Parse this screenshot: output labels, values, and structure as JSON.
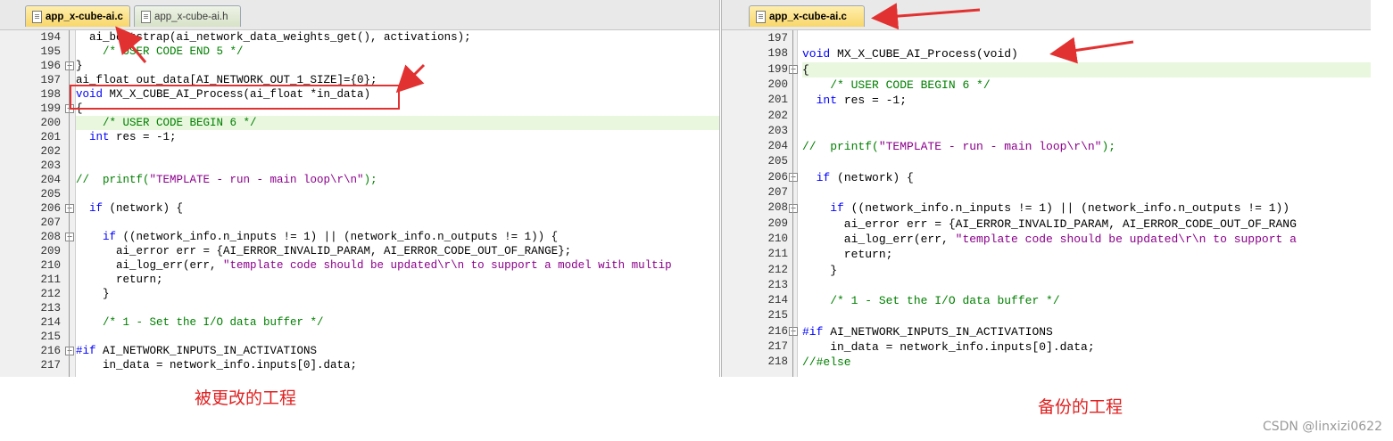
{
  "left": {
    "tabs": [
      {
        "label": "app_x-cube-ai.c",
        "active": true
      },
      {
        "label": "app_x-cube-ai.h",
        "active": false
      }
    ],
    "lines": [
      {
        "n": "194",
        "text": "  ai_bootstrap(ai_network_data_weights_get(), activations);"
      },
      {
        "n": "195",
        "text": "    /* USER CODE END 5 */"
      },
      {
        "n": "196",
        "text": "}"
      },
      {
        "n": "197",
        "text": "ai_float out_data[AI_NETWORK_OUT_1_SIZE]={0};"
      },
      {
        "n": "198",
        "text": "void MX_X_CUBE_AI_Process(ai_float *in_data)"
      },
      {
        "n": "199",
        "text": "{"
      },
      {
        "n": "200",
        "text": "    /* USER CODE BEGIN 6 */"
      },
      {
        "n": "201",
        "text": "  int res = -1;"
      },
      {
        "n": "202",
        "text": ""
      },
      {
        "n": "203",
        "text": ""
      },
      {
        "n": "204",
        "text": "//  printf(\"TEMPLATE - run - main loop\\r\\n\");"
      },
      {
        "n": "205",
        "text": ""
      },
      {
        "n": "206",
        "text": "  if (network) {"
      },
      {
        "n": "207",
        "text": ""
      },
      {
        "n": "208",
        "text": "    if ((network_info.n_inputs != 1) || (network_info.n_outputs != 1)) {"
      },
      {
        "n": "209",
        "text": "      ai_error err = {AI_ERROR_INVALID_PARAM, AI_ERROR_CODE_OUT_OF_RANGE};"
      },
      {
        "n": "210",
        "text": "      ai_log_err(err, \"template code should be updated\\r\\n to support a model with multip"
      },
      {
        "n": "211",
        "text": "      return;"
      },
      {
        "n": "212",
        "text": "    }"
      },
      {
        "n": "213",
        "text": ""
      },
      {
        "n": "214",
        "text": "    /* 1 - Set the I/O data buffer */"
      },
      {
        "n": "215",
        "text": ""
      },
      {
        "n": "216",
        "text": "#if AI_NETWORK_INPUTS_IN_ACTIVATIONS"
      },
      {
        "n": "217",
        "text": "    in_data = network_info.inputs[0].data;"
      }
    ],
    "caption": "被更改的工程"
  },
  "right": {
    "tabs": [
      {
        "label": "app_x-cube-ai.c",
        "active": true
      }
    ],
    "lines": [
      {
        "n": "197",
        "text": ""
      },
      {
        "n": "198",
        "text": "void MX_X_CUBE_AI_Process(void)"
      },
      {
        "n": "199",
        "text": "{"
      },
      {
        "n": "200",
        "text": "    /* USER CODE BEGIN 6 */"
      },
      {
        "n": "201",
        "text": "  int res = -1;"
      },
      {
        "n": "202",
        "text": ""
      },
      {
        "n": "203",
        "text": ""
      },
      {
        "n": "204",
        "text": "//  printf(\"TEMPLATE - run - main loop\\r\\n\");"
      },
      {
        "n": "205",
        "text": ""
      },
      {
        "n": "206",
        "text": "  if (network) {"
      },
      {
        "n": "207",
        "text": ""
      },
      {
        "n": "208",
        "text": "    if ((network_info.n_inputs != 1) || (network_info.n_outputs != 1))"
      },
      {
        "n": "209",
        "text": "      ai_error err = {AI_ERROR_INVALID_PARAM, AI_ERROR_CODE_OUT_OF_RANG"
      },
      {
        "n": "210",
        "text": "      ai_log_err(err, \"template code should be updated\\r\\n to support a"
      },
      {
        "n": "211",
        "text": "      return;"
      },
      {
        "n": "212",
        "text": "    }"
      },
      {
        "n": "213",
        "text": ""
      },
      {
        "n": "214",
        "text": "    /* 1 - Set the I/O data buffer */"
      },
      {
        "n": "215",
        "text": ""
      },
      {
        "n": "216",
        "text": "#if AI_NETWORK_INPUTS_IN_ACTIVATIONS"
      },
      {
        "n": "217",
        "text": "    in_data = network_info.inputs[0].data;"
      },
      {
        "n": "218",
        "text": "//#else"
      }
    ],
    "caption": "备份的工程"
  },
  "watermark": "CSDN @linxizi0622",
  "colors": {
    "keyword": "#0000ff",
    "comment": "#008000",
    "string": "#8b008b",
    "current_line": "#e9f7df",
    "annotation": "#e23131",
    "active_tab": "#f8d66a"
  }
}
